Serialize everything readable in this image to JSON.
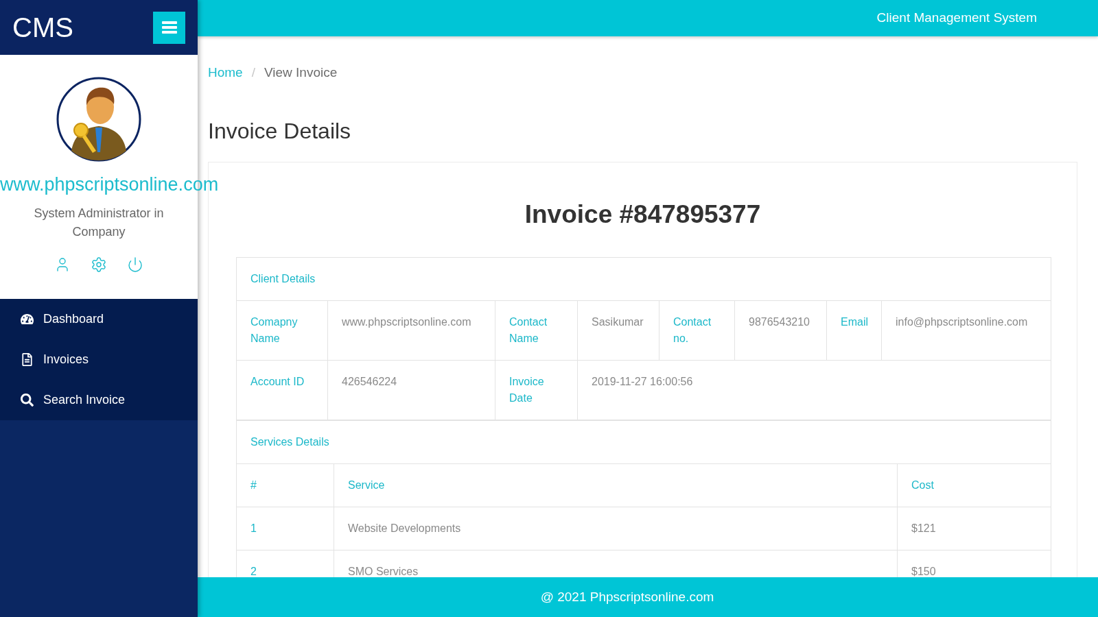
{
  "sidebar": {
    "brand": "CMS",
    "profile": {
      "site": "www.phpscriptsonline.com",
      "role": "System Administrator in Company"
    },
    "nav": [
      {
        "label": "Dashboard"
      },
      {
        "label": "Invoices"
      },
      {
        "label": "Search Invoice"
      }
    ]
  },
  "topbar": {
    "title": "Client Management System"
  },
  "breadcrumb": {
    "items": [
      {
        "label": "Home",
        "kind": "link"
      },
      {
        "label": "View Invoice",
        "kind": "current"
      }
    ],
    "separator": "/"
  },
  "page_title": "Invoice Details",
  "invoice": {
    "title": "Invoice #847895377",
    "client_details": {
      "heading": "Client Details",
      "rows": [
        [
          {
            "label": "Comapny Name",
            "value": "www.phpscriptsonline.com"
          },
          {
            "label": "Contact Name",
            "value": "Sasikumar"
          },
          {
            "label": "Contact no.",
            "value": "9876543210"
          },
          {
            "label": "Email",
            "value": "info@phpscriptsonline.com"
          }
        ],
        [
          {
            "label": "Account ID",
            "value": "426546224"
          },
          {
            "label": "Invoice Date",
            "value": "2019-11-27 16:00:56"
          }
        ]
      ]
    },
    "services": {
      "heading": "Services Details",
      "columns": [
        "#",
        "Service",
        "Cost"
      ],
      "rows": [
        [
          "1",
          "Website Developments",
          "$121"
        ],
        [
          "2",
          "SMO Services",
          "$150"
        ]
      ]
    }
  },
  "footer": {
    "text": "@ 2021 Phpscriptsonline.com"
  }
}
